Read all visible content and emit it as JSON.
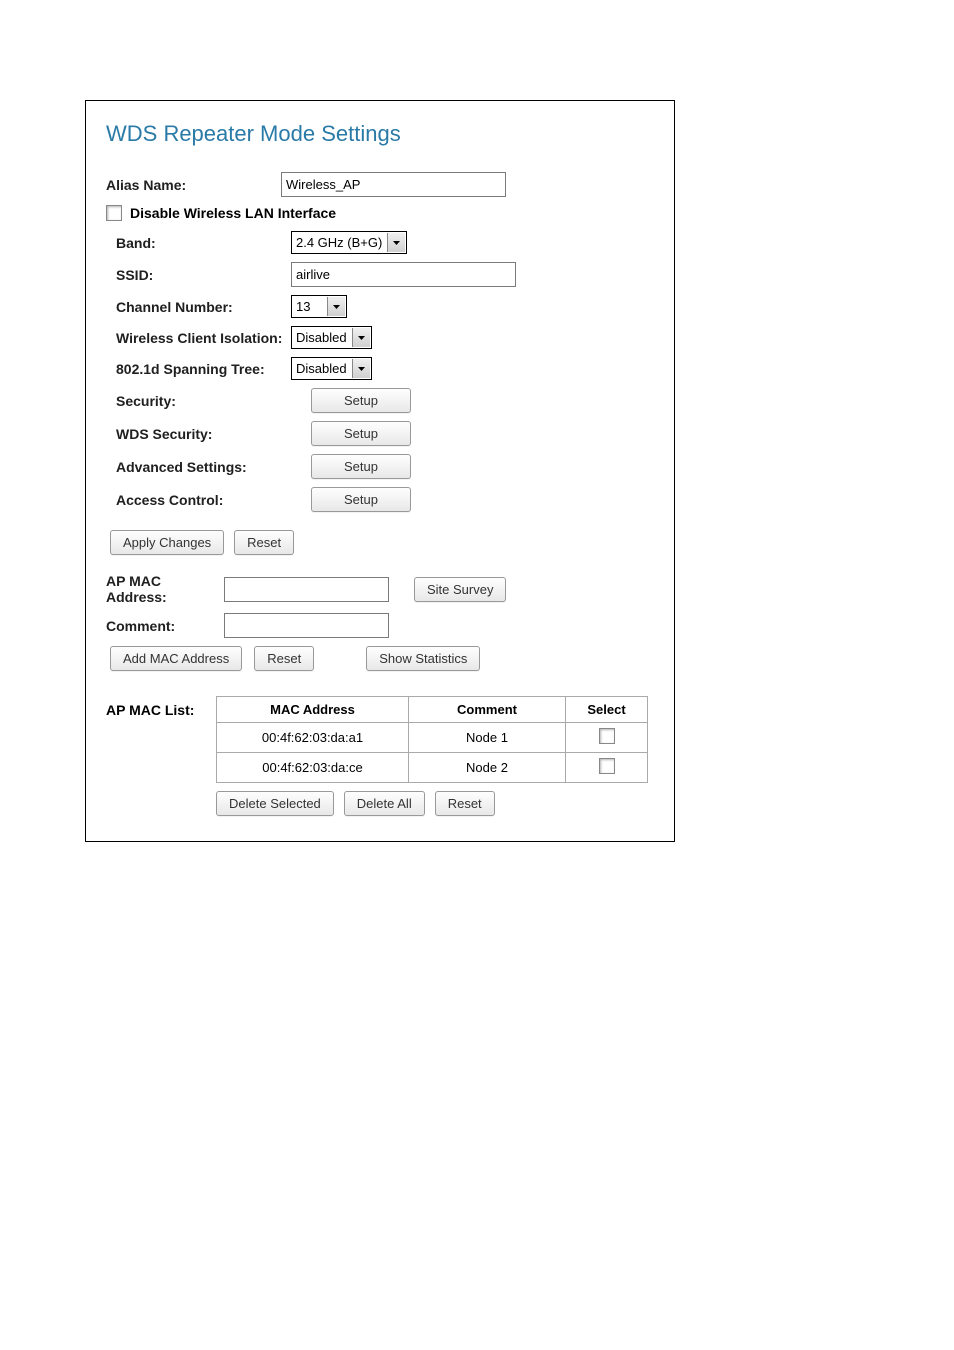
{
  "title": "WDS Repeater Mode Settings",
  "fields": {
    "alias_label": "Alias Name:",
    "alias_value": "Wireless_AP",
    "disable_label": "Disable Wireless LAN Interface",
    "band_label": "Band:",
    "band_value": "2.4 GHz (B+G)",
    "ssid_label": "SSID:",
    "ssid_value": "airlive",
    "channel_label": "Channel Number:",
    "channel_value": "13",
    "isolation_label": "Wireless Client Isolation:",
    "isolation_value": "Disabled",
    "spanning_label": "802.1d Spanning Tree:",
    "spanning_value": "Disabled",
    "security_label": "Security:",
    "wds_security_label": "WDS Security:",
    "advanced_label": "Advanced Settings:",
    "access_label": "Access Control:",
    "setup_btn": "Setup"
  },
  "buttons": {
    "apply_changes": "Apply Changes",
    "reset": "Reset",
    "site_survey": "Site Survey",
    "add_mac": "Add MAC Address",
    "show_stats": "Show Statistics",
    "delete_selected": "Delete Selected",
    "delete_all": "Delete All"
  },
  "mac_section": {
    "ap_mac_label": "AP MAC Address:",
    "comment_label": "Comment:",
    "list_label": "AP MAC List:"
  },
  "table": {
    "headers": {
      "mac": "MAC Address",
      "comment": "Comment",
      "select": "Select"
    },
    "rows": [
      {
        "mac": "00:4f:62:03:da:a1",
        "comment": "Node 1"
      },
      {
        "mac": "00:4f:62:03:da:ce",
        "comment": "Node 2"
      }
    ]
  }
}
